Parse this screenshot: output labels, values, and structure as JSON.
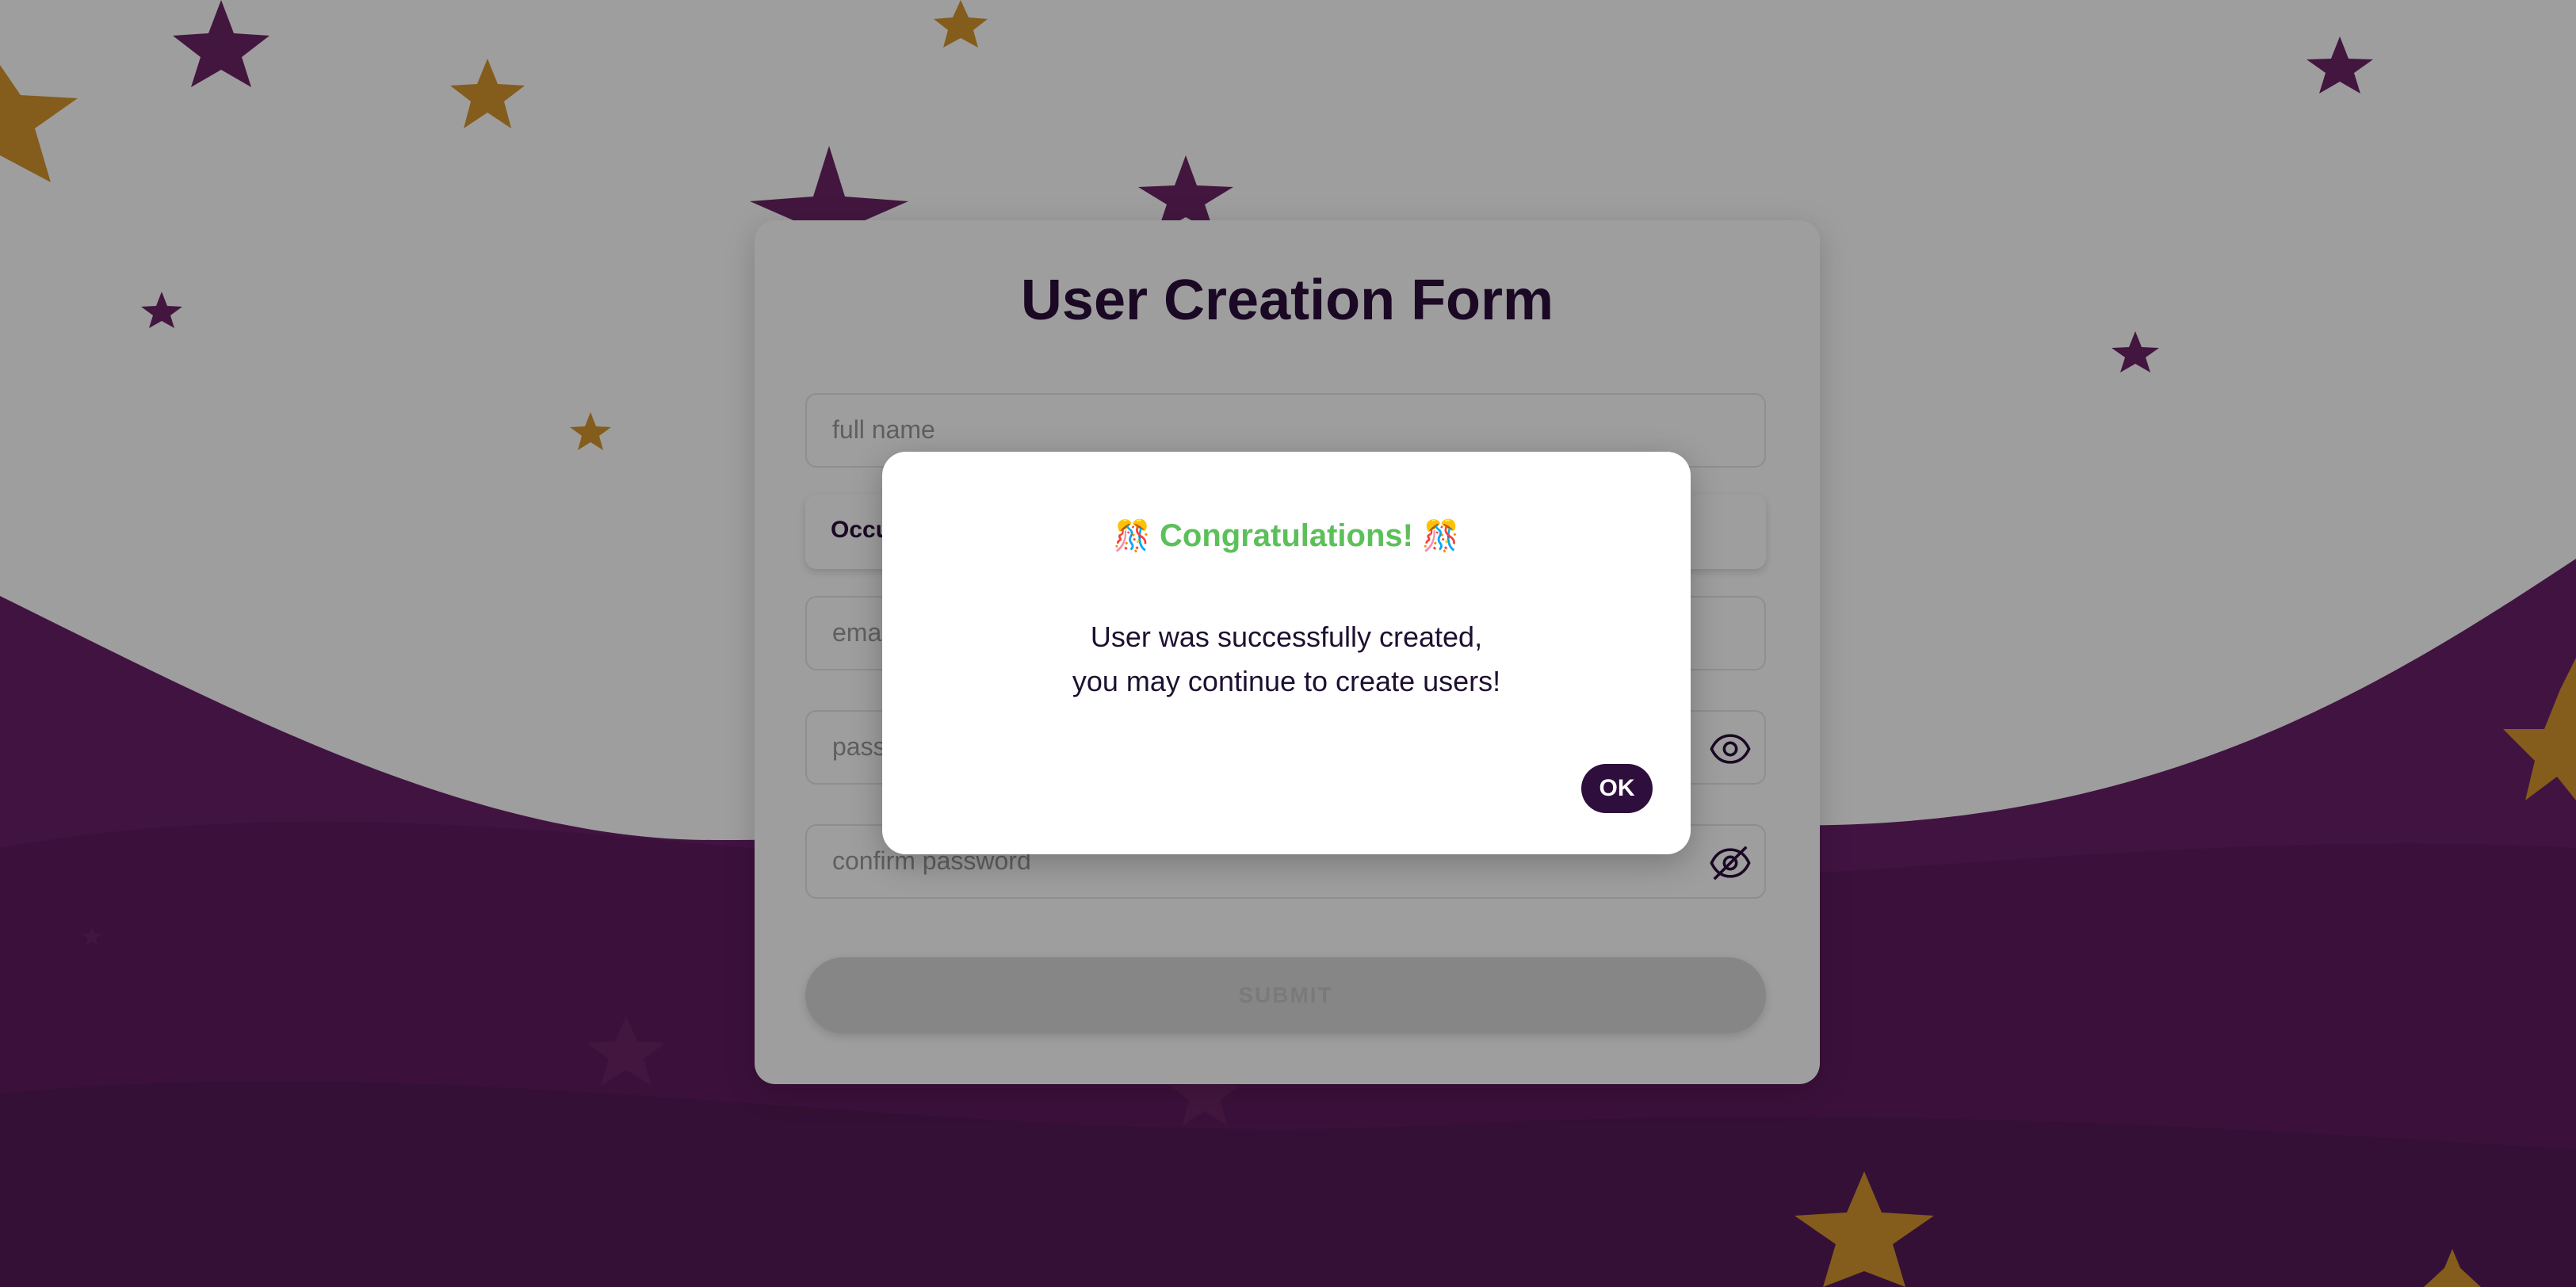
{
  "form": {
    "title": "User Creation Form",
    "full_name_placeholder": "full name",
    "occupation_label": "Occupation",
    "email_placeholder": "email",
    "password_placeholder": "password",
    "confirm_password_placeholder": "confirm password",
    "submit_label": "SUBMIT"
  },
  "modal": {
    "emoji": "🎊",
    "title": "Congratulations!",
    "message_line1": "User was successfully created,",
    "message_line2": "you may continue to create users!",
    "ok_label": "OK"
  },
  "colors": {
    "accent_dark": "#2e0e3c",
    "success_green": "#5cc05a",
    "wave_purple": "#5b1a5a",
    "star_gold": "#d6952e"
  }
}
